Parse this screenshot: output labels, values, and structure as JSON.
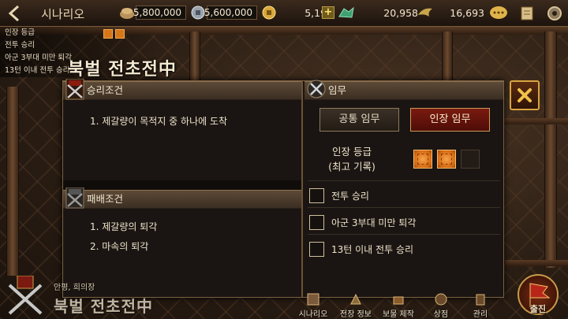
{
  "topbar": {
    "title": "시나리오",
    "rice": "5,800,000",
    "silver": "5,600,000",
    "gold": "5,196",
    "jade": "20,958",
    "honor": "16,693",
    "plus_label": "+"
  },
  "mission_info": {
    "grade_label": "인장 등급",
    "missions": [
      "전투 승리",
      "아군 3부대 미만 퇴각",
      "13턴 이내 전투 승리"
    ]
  },
  "scenario_title": "북벌 전초전中",
  "dialog": {
    "victory": {
      "header": "승리조건",
      "conditions": [
        "1. 제갈량이 목적지 중 하나에 도착"
      ]
    },
    "defeat": {
      "header": "패배조건",
      "conditions": [
        "1. 제갈량의 퇴각",
        "2. 마속의 퇴각"
      ]
    },
    "missions": {
      "header": "임무",
      "tabs": {
        "common": "공통 임무",
        "general": "인장 임무"
      },
      "grade_label": "인장 등급",
      "grade_sub": "(최고 기록)",
      "grade": {
        "earned": 2,
        "total": 3
      },
      "checks": [
        "전투 승리",
        "아군 3부대 미만 퇴각",
        "13턴 이내 전투 승리"
      ]
    },
    "close_label": "X"
  },
  "bottom": {
    "general_line": "안평, 희의장",
    "title": "북벌 전초전中",
    "nav": [
      "시나리오",
      "전장 정보",
      "보물 제작",
      "상점",
      "관리"
    ],
    "depart": "출진"
  },
  "colors": {
    "accent_gold": "#d9a441",
    "active_tab": "#7a1a10",
    "seal_orange": "#d66a12"
  }
}
